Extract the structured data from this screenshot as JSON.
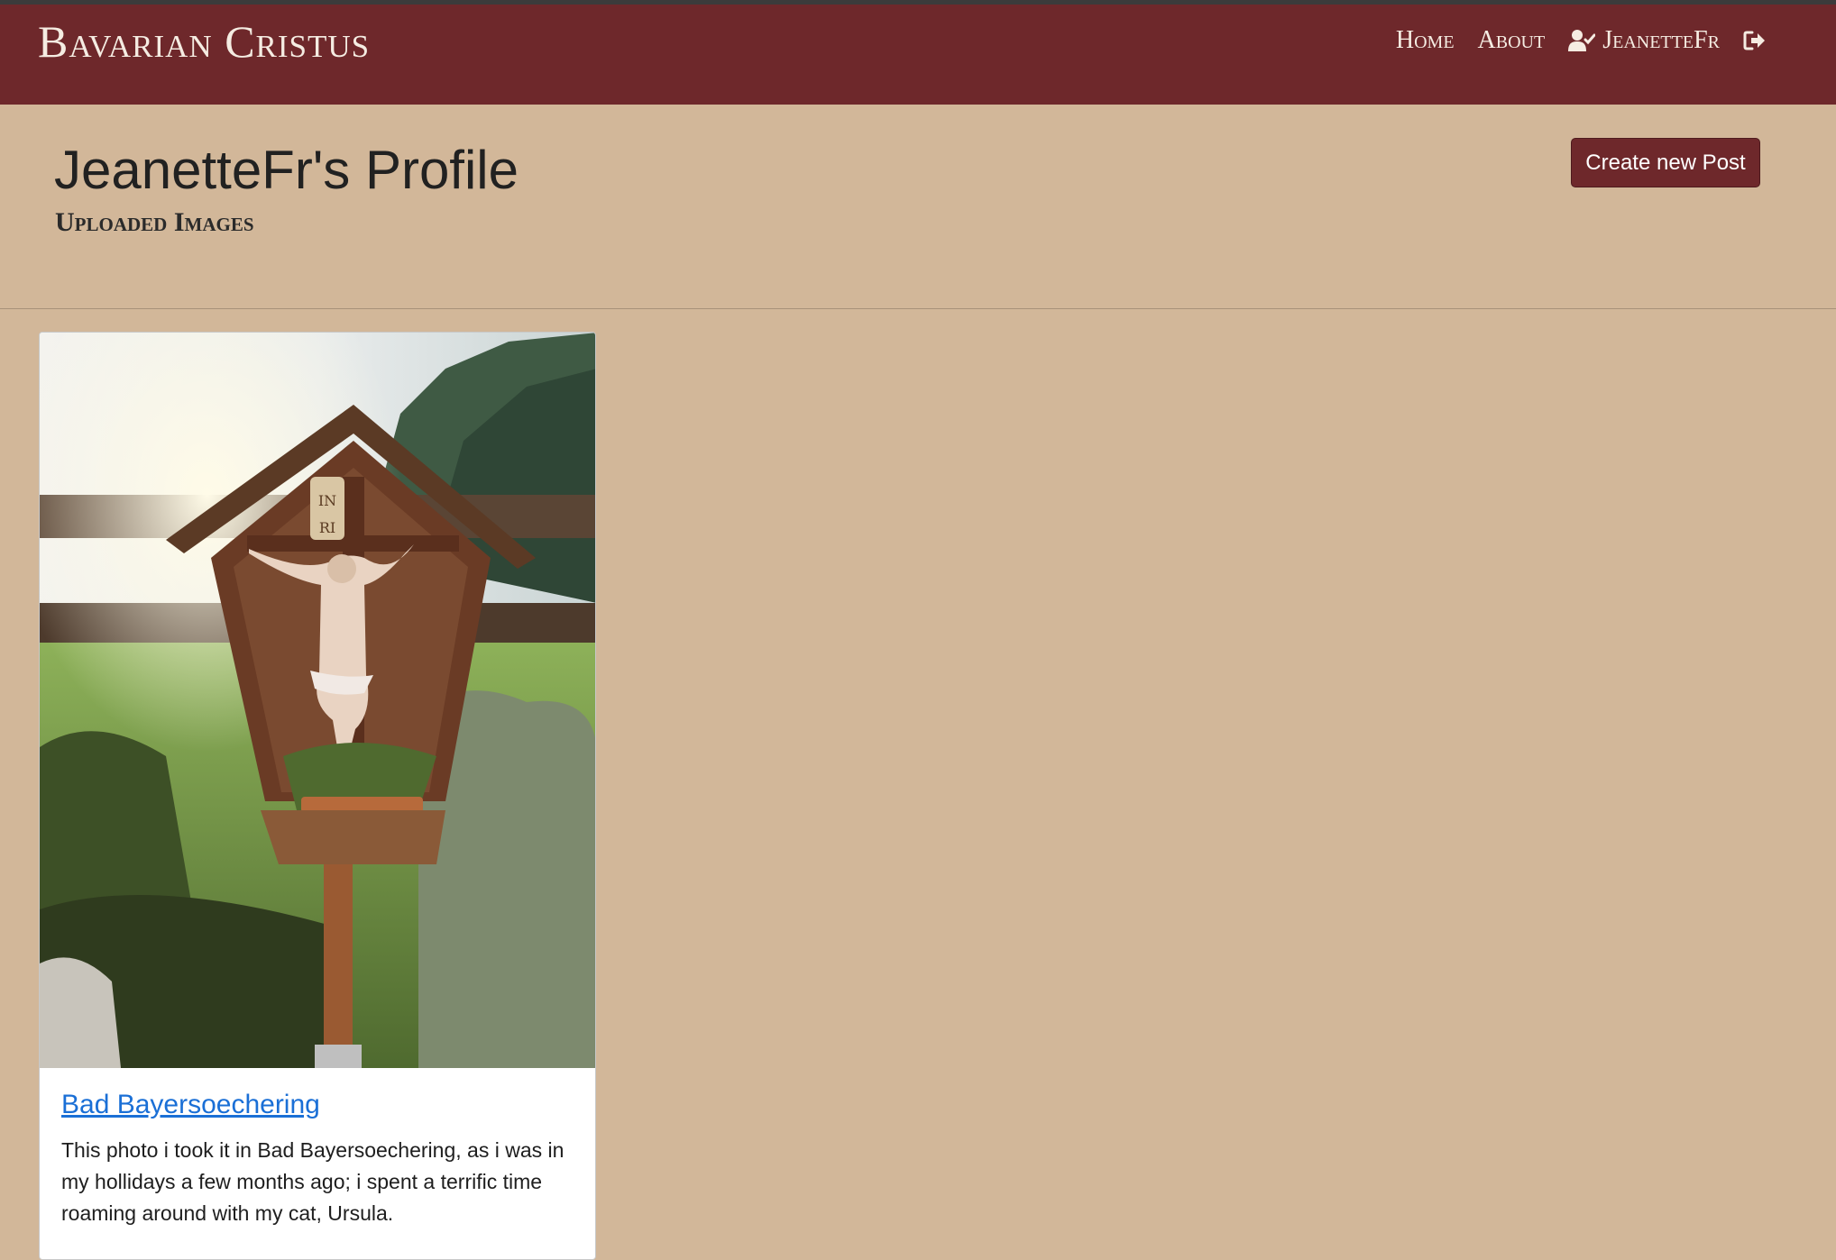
{
  "navbar": {
    "brand": "Bavarian Cristus",
    "links": {
      "home": "Home",
      "about": "About",
      "user": "JeanetteFr"
    },
    "icons": {
      "user": "user-check-icon",
      "logout": "sign-out-icon"
    },
    "colors": {
      "background": "#6e282b",
      "text": "#f5ece2"
    }
  },
  "header": {
    "title": "JeanetteFr's Profile",
    "subtitle": "Uploaded Images",
    "create_button": "Create new Post"
  },
  "posts": [
    {
      "title": "Bad Bayersoechering",
      "description": "This photo i took it in Bad Bayersoechering, as i was in my hollidays a few months ago; i spent a terrific time roaming around with my cat, Ursula."
    }
  ],
  "colors": {
    "page_background": "#d2b799",
    "accent": "#6e282b",
    "link": "#1a6fd6"
  }
}
